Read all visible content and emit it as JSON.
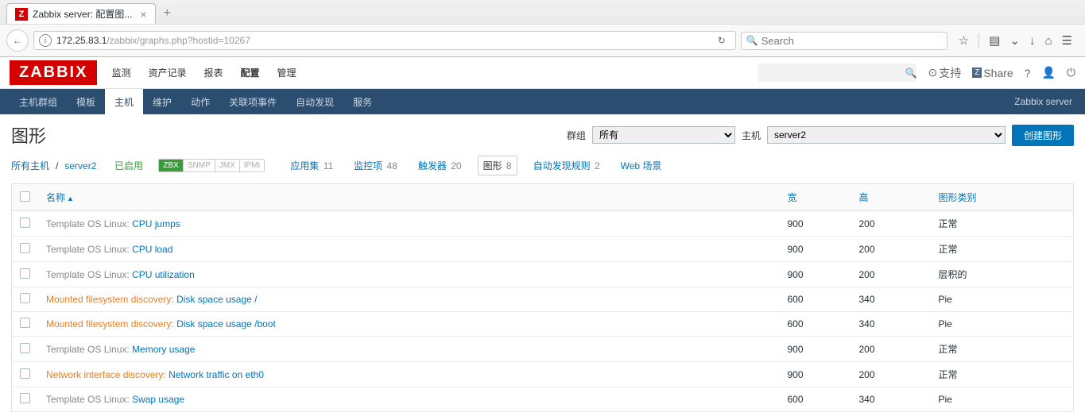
{
  "browser": {
    "tab_title": "Zabbix server: 配置图...",
    "tab_favicon": "Z",
    "url_host": "172.25.83.1",
    "url_path": "/zabbix/graphs.php?hostid=10267",
    "search_placeholder": "Search"
  },
  "header": {
    "logo": "ZABBIX",
    "nav": [
      "监测",
      "资产记录",
      "报表",
      "配置",
      "管理"
    ],
    "nav_active": 3,
    "support": "支持",
    "share": "Share"
  },
  "subnav": {
    "items": [
      "主机群组",
      "模板",
      "主机",
      "维护",
      "动作",
      "关联项事件",
      "自动发现",
      "服务"
    ],
    "active": 2,
    "right": "Zabbix server"
  },
  "page": {
    "title": "图形",
    "group_label": "群组",
    "group_value": "所有",
    "host_label": "主机",
    "host_value": "server2",
    "create_btn": "创建图形"
  },
  "crumb": {
    "all_hosts": "所有主机",
    "host": "server2",
    "status": "已启用",
    "badges": [
      "ZBX",
      "SNMP",
      "JMX",
      "IPMI"
    ],
    "tabs": [
      {
        "label": "应用集",
        "count": "11"
      },
      {
        "label": "监控项",
        "count": "48"
      },
      {
        "label": "触发器",
        "count": "20"
      },
      {
        "label": "图形",
        "count": "8",
        "active": true
      },
      {
        "label": "自动发现规则",
        "count": "2"
      },
      {
        "label": "Web 场景",
        "count": ""
      }
    ]
  },
  "table": {
    "cols": {
      "name": "名称",
      "width": "宽",
      "height": "高",
      "type": "图形类别"
    },
    "rows": [
      {
        "tmpl": "Template OS Linux",
        "tmpl_style": "gray",
        "name": "CPU jumps",
        "w": "900",
        "h": "200",
        "type": "正常"
      },
      {
        "tmpl": "Template OS Linux",
        "tmpl_style": "gray",
        "name": "CPU load",
        "w": "900",
        "h": "200",
        "type": "正常"
      },
      {
        "tmpl": "Template OS Linux",
        "tmpl_style": "gray",
        "name": "CPU utilization",
        "w": "900",
        "h": "200",
        "type": "层积的"
      },
      {
        "tmpl": "Mounted filesystem discovery",
        "tmpl_style": "orange",
        "name": "Disk space usage /",
        "w": "600",
        "h": "340",
        "type": "Pie"
      },
      {
        "tmpl": "Mounted filesystem discovery",
        "tmpl_style": "orange",
        "name": "Disk space usage /boot",
        "w": "600",
        "h": "340",
        "type": "Pie"
      },
      {
        "tmpl": "Template OS Linux",
        "tmpl_style": "gray",
        "name": "Memory usage",
        "w": "900",
        "h": "200",
        "type": "正常"
      },
      {
        "tmpl": "Network interface discovery",
        "tmpl_style": "orange",
        "name": "Network traffic on eth0",
        "w": "900",
        "h": "200",
        "type": "正常"
      },
      {
        "tmpl": "Template OS Linux",
        "tmpl_style": "gray",
        "name": "Swap usage",
        "w": "600",
        "h": "340",
        "type": "Pie"
      }
    ]
  }
}
